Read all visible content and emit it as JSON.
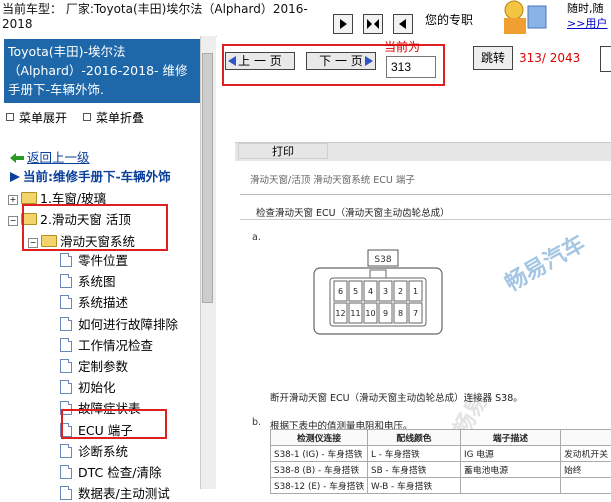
{
  "top": {
    "model_text": "当前车型： 厂家:Toyota(丰田)埃尔法（Alphard）2016-2018",
    "my_pro_text": "您的专职",
    "right_text_1": "随时,随",
    "right_text_2": ">>用户"
  },
  "left": {
    "header_title": "Toyota(丰田)-埃尔法（Alphard）-2016-2018- 维修手册下-车辆外饰.",
    "expand_label": "菜单展开",
    "collapse_label": "菜单折叠",
    "back_label": "返回上一级",
    "current_label": "当前:维修手册下-车辆外饰",
    "tree": [
      {
        "label": "1.车窗/玻璃",
        "sign": "+"
      },
      {
        "label": "2.滑动天窗 活顶",
        "sign": "−"
      },
      {
        "label": "滑动天窗系统",
        "sign": "−"
      }
    ],
    "docs": [
      "零件位置",
      "系统图",
      "系统描述",
      "如何进行故障排除",
      "工作情况检查",
      "定制参数",
      "初始化",
      "故障症状表",
      "ECU 端子",
      "诊断系统",
      "DTC 检查/清除",
      "数据表/主动测试"
    ]
  },
  "toolbar": {
    "prev_label": "上 一 页",
    "next_label": "下 一 页",
    "current_label": "当前为",
    "page_value": "313",
    "jump_label": "跳转",
    "count_text": "313/ 2043"
  },
  "doc": {
    "print_label": "打印",
    "breadcrumb": "滑动天窗/活顶  滑动天窗系统  ECU 端子",
    "section_title": "检查滑动天窗 ECU（滑动天窗主动齿轮总成）",
    "step_a": "a.",
    "step_b": "b.",
    "connector_label": "S38",
    "pin_numbers_top": [
      "6",
      "5",
      "4",
      "3",
      "2",
      "1"
    ],
    "pin_numbers_bottom": [
      "12",
      "11",
      "10",
      "9",
      "8",
      "7"
    ],
    "disconnect_text": "断开滑动天窗 ECU（滑动天窗主动齿轮总成）连接器 S38。",
    "measure_text": "根据下表中的值测量电阻和电压。",
    "watermark": "畅易汽车",
    "watermark2": "畅易",
    "table": {
      "headers": [
        "检测仪连接",
        "配线颜色",
        "端子描述",
        ""
      ],
      "rows": [
        [
          "S38-1 (IG) - 车身搭铁",
          "L - 车身搭铁",
          "IG 电源",
          "发动机开关"
        ],
        [
          "S38-8 (B) - 车身搭铁",
          "SB - 车身搭铁",
          "蓄电池电源",
          "始终"
        ],
        [
          "S38-12 (E) - 车身搭铁",
          "W-B - 车身搭铁",
          "",
          ""
        ]
      ]
    }
  }
}
